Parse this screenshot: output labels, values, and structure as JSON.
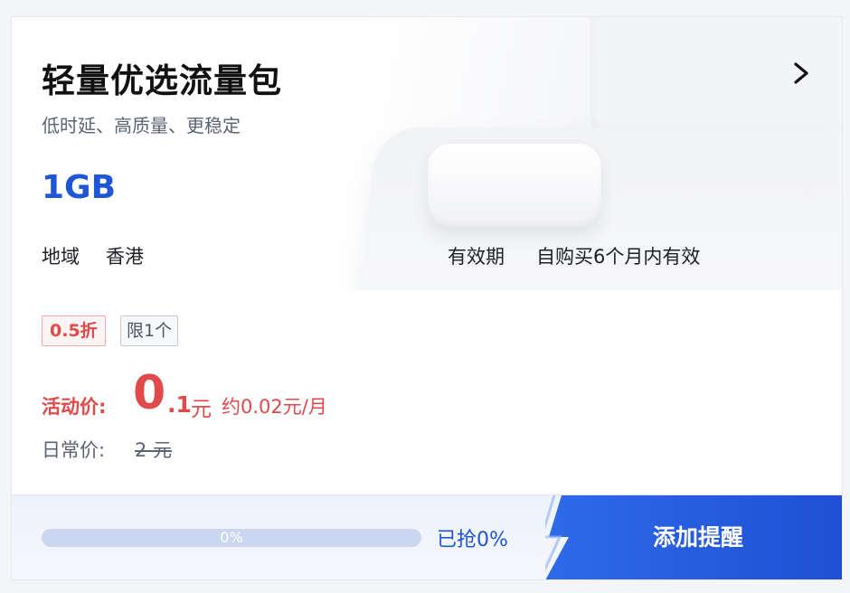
{
  "card": {
    "title": "轻量优选流量包",
    "subtitle": "低时延、高质量、更稳定",
    "spec": "1GB",
    "arrow_icon": "chevron-right-icon"
  },
  "attributes": {
    "region_label": "地域",
    "region_value": "香港",
    "validity_label": "有效期",
    "validity_value": "自购买6个月内有效"
  },
  "tags": {
    "discount": "0.5折",
    "limit": "限1个"
  },
  "price": {
    "activity_label": "活动价:",
    "integer": "0",
    "decimal": ".1",
    "unit": "元",
    "monthly": "约0.02元/月",
    "regular_label": "日常价:",
    "regular_value": "2 元"
  },
  "progress": {
    "percent_text": "0%",
    "fraction": 0,
    "grabbed": "已抢0%"
  },
  "cta": {
    "label": "添加提醒"
  },
  "colors": {
    "accent": "#1e56d6",
    "price_red": "#e04a4a",
    "cta_blue": "#2f64e0"
  }
}
